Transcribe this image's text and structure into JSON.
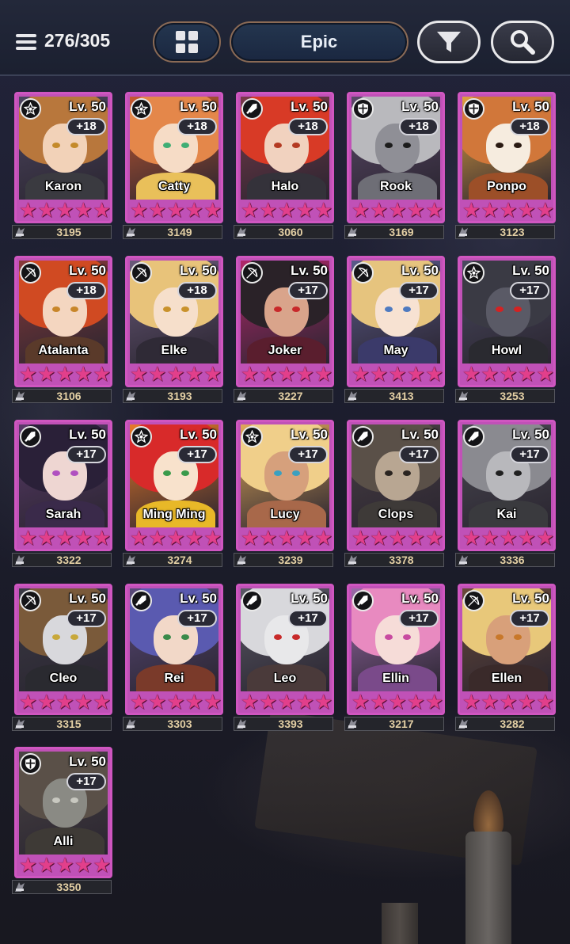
{
  "header": {
    "menu_icon": "hamburger-menu-icon",
    "count": "276/305",
    "grid_icon": "grid-view-icon",
    "rarity_filter": "Epic",
    "filter_icon": "funnel-filter-icon",
    "search_icon": "magnifier-search-icon"
  },
  "heroes": [
    {
      "name": "Karon",
      "level": "Lv. 50",
      "plus": "+18",
      "role": "star",
      "power": "3195",
      "stars": 5,
      "hair": "#b8773c",
      "face": "#f2d2b8",
      "eye": "#c48a2a",
      "body": "#3a3a40",
      "bg": "#4d4660"
    },
    {
      "name": "Catty",
      "level": "Lv. 50",
      "plus": "+18",
      "role": "star",
      "power": "3149",
      "stars": 5,
      "hair": "#e4874a",
      "face": "#f6dcc6",
      "eye": "#3fae74",
      "body": "#e9c05a",
      "bg": "#c75a30"
    },
    {
      "name": "Halo",
      "level": "Lv. 50",
      "plus": "+18",
      "role": "sword",
      "power": "3060",
      "stars": 5,
      "hair": "#d83a26",
      "face": "#f1d2bf",
      "eye": "#b43a22",
      "body": "#34323a",
      "bg": "#7a3a4a"
    },
    {
      "name": "Rook",
      "level": "Lv. 50",
      "plus": "+18",
      "role": "shield",
      "power": "3169",
      "stars": 5,
      "hair": "#b9b9bd",
      "face": "#8f8f96",
      "eye": "#1c1c1c",
      "body": "#6e6e76",
      "bg": "#5c4a6a"
    },
    {
      "name": "Ponpo",
      "level": "Lv. 50",
      "plus": "+18",
      "role": "shield",
      "power": "3123",
      "stars": 5,
      "hair": "#d1773a",
      "face": "#f6ecdf",
      "eye": "#2a1a12",
      "body": "#9c4f28",
      "bg": "#e0a040"
    },
    {
      "name": "Atalanta",
      "level": "Lv. 50",
      "plus": "+18",
      "role": "bow",
      "power": "3106",
      "stars": 5,
      "hair": "#d04a22",
      "face": "#f4d6c0",
      "eye": "#c8862a",
      "body": "#5a3a2a",
      "bg": "#8a3a3a"
    },
    {
      "name": "Elke",
      "level": "Lv. 50",
      "plus": "+18",
      "role": "bow",
      "power": "3193",
      "stars": 5,
      "hair": "#e8c37a",
      "face": "#f6dfcb",
      "eye": "#c9922c",
      "body": "#2f2a36",
      "bg": "#6a5a7a"
    },
    {
      "name": "Joker",
      "level": "Lv. 50",
      "plus": "+17",
      "role": "bow",
      "power": "3227",
      "stars": 5,
      "hair": "#2a2228",
      "face": "#d9a48b",
      "eye": "#c8282a",
      "body": "#5a1e2e",
      "bg": "#b0286a"
    },
    {
      "name": "May",
      "level": "Lv. 50",
      "plus": "+17",
      "role": "bow",
      "power": "3413",
      "stars": 5,
      "hair": "#e6c47e",
      "face": "#f7e2d2",
      "eye": "#4e7ac0",
      "body": "#3b3a6a",
      "bg": "#5a5a8a"
    },
    {
      "name": "Howl",
      "level": "Lv. 50",
      "plus": "+17",
      "role": "star",
      "power": "3253",
      "stars": 5,
      "hair": "#3a3a44",
      "face": "#5a5a66",
      "eye": "#d42222",
      "body": "#2a2a30",
      "bg": "#4a4a60"
    },
    {
      "name": "Sarah",
      "level": "Lv. 50",
      "plus": "+17",
      "role": "sword",
      "power": "3322",
      "stars": 5,
      "hair": "#2a2038",
      "face": "#eed6d2",
      "eye": "#b050c0",
      "body": "#3a2a4a",
      "bg": "#5a3a6a"
    },
    {
      "name": "Ming Ming",
      "level": "Lv. 50",
      "plus": "+17",
      "role": "star",
      "power": "3274",
      "stars": 5,
      "hair": "#d82a2a",
      "face": "#f8e2cc",
      "eye": "#3a9a4a",
      "body": "#e8b828",
      "bg": "#e87a28"
    },
    {
      "name": "Lucy",
      "level": "Lv. 50",
      "plus": "+17",
      "role": "star",
      "power": "3239",
      "stars": 5,
      "hair": "#f0cf8a",
      "face": "#d6a07c",
      "eye": "#3aa0c0",
      "body": "#a8684a",
      "bg": "#e0a85a"
    },
    {
      "name": "Clops",
      "level": "Lv. 50",
      "plus": "+17",
      "role": "sword",
      "power": "3378",
      "stars": 5,
      "hair": "#5a5048",
      "face": "#b8a692",
      "eye": "#2a2420",
      "body": "#3e3a38",
      "bg": "#4a4044"
    },
    {
      "name": "Kai",
      "level": "Lv. 50",
      "plus": "+17",
      "role": "sword",
      "power": "3336",
      "stars": 5,
      "hair": "#8a8a90",
      "face": "#b8b8bc",
      "eye": "#202020",
      "body": "#3a3a3e",
      "bg": "#4a4a52"
    },
    {
      "name": "Cleo",
      "level": "Lv. 50",
      "plus": "+17",
      "role": "bow",
      "power": "3315",
      "stars": 5,
      "hair": "#7a5a3a",
      "face": "#d8d8dc",
      "eye": "#c8a83a",
      "body": "#2a2a30",
      "bg": "#3a3a44"
    },
    {
      "name": "Rei",
      "level": "Lv. 50",
      "plus": "+17",
      "role": "sword",
      "power": "3303",
      "stars": 5,
      "hair": "#5a5ab0",
      "face": "#f2d8c8",
      "eye": "#3a8a4a",
      "body": "#7a3a2a",
      "bg": "#5a4a7a"
    },
    {
      "name": "Leo",
      "level": "Lv. 50",
      "plus": "+17",
      "role": "sword",
      "power": "3393",
      "stars": 5,
      "hair": "#d8d8dc",
      "face": "#e8e8ea",
      "eye": "#c82a2a",
      "body": "#4a3a3a",
      "bg": "#5a5a66"
    },
    {
      "name": "Ellin",
      "level": "Lv. 50",
      "plus": "+17",
      "role": "sword",
      "power": "3217",
      "stars": 5,
      "hair": "#e88ac0",
      "face": "#f6dcd8",
      "eye": "#c84aa0",
      "body": "#7a4a8a",
      "bg": "#9a6aa8"
    },
    {
      "name": "Ellen",
      "level": "Lv. 50",
      "plus": "+17",
      "role": "bow",
      "power": "3282",
      "stars": 5,
      "hair": "#e8c87a",
      "face": "#d8a07a",
      "eye": "#c8782a",
      "body": "#3a2a2a",
      "bg": "#6a4a3a"
    },
    {
      "name": "Alli",
      "level": "Lv. 50",
      "plus": "+17",
      "role": "shield",
      "power": "3350",
      "stars": 5,
      "hair": "#5a5048",
      "face": "#8a8a84",
      "eye": "#c8c8c0",
      "body": "#3e3a36",
      "bg": "#4a4444"
    }
  ]
}
